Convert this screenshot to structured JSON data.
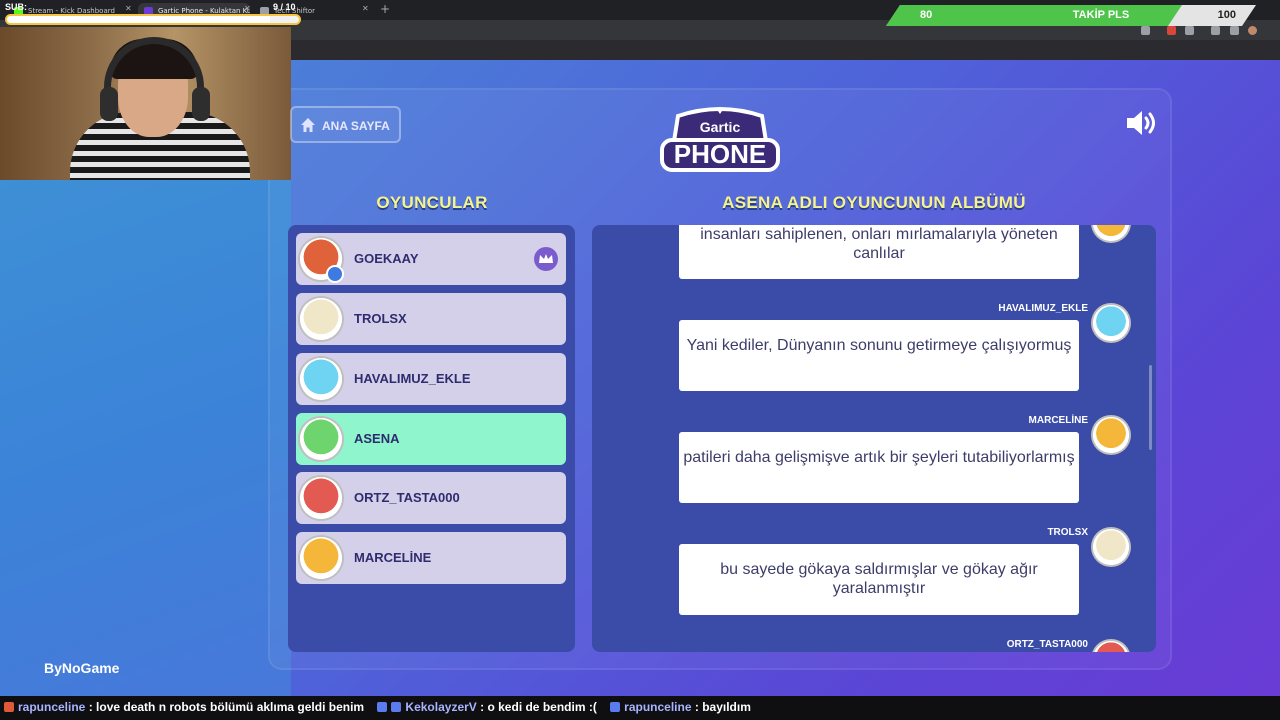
{
  "browser": {
    "tabs": [
      {
        "title": "Stream - Kick Dashboard",
        "fav_color": "#53fc18"
      },
      {
        "title": "Gartic Phone - Kulaktan Kulağa",
        "fav_color": "#6a3bd6"
      },
      {
        "title": "Tech Shiftor",
        "fav_color": "#9aa0a6"
      }
    ]
  },
  "overlay": {
    "sub_label": "SUB:",
    "sub_count": "9 / 10",
    "sub_progress": 0.9,
    "follow_current": "80",
    "follow_label": "TAKİP PLS",
    "follow_max": "100",
    "follow_progress": 0.8
  },
  "game": {
    "home_button": "ANA SAYFA",
    "logo_top": "Gartic",
    "logo_main": "PHONE",
    "players_heading": "OYUNCULAR",
    "album_heading": "ASENA ADLI OYUNCUNUN ALBÜMÜ",
    "players": [
      {
        "name": "GOEKAAY",
        "host": true,
        "active": false,
        "avatar_color": "#e0623a"
      },
      {
        "name": "TROLSX",
        "host": false,
        "active": false,
        "avatar_color": "#f0e7c8"
      },
      {
        "name": "HAVALIMUZ_EKLE",
        "host": false,
        "active": false,
        "avatar_color": "#6fd3f2"
      },
      {
        "name": "ASENA",
        "host": false,
        "active": true,
        "avatar_color": "#6ed46e"
      },
      {
        "name": "ORTZ_TASTA000",
        "host": false,
        "active": false,
        "avatar_color": "#e25a52"
      },
      {
        "name": "MARCELİNE",
        "host": false,
        "active": false,
        "avatar_color": "#f4b73a"
      }
    ],
    "album": [
      {
        "author": "",
        "text": "insanları sahiplenen, onları mırlamalarıyla yöneten canlılar",
        "avatar_color": "#f4b73a"
      },
      {
        "author": "HAVALIMUZ_EKLE",
        "text": "Yani kediler, Dünyanın sonunu getirmeye çalışıyormuş",
        "avatar_color": "#6fd3f2"
      },
      {
        "author": "MARCELİNE",
        "text": "patileri daha gelişmişve artık bir şeyleri tutabiliyorlarmış",
        "avatar_color": "#f4b73a"
      },
      {
        "author": "TROLSX",
        "text": "bu sayede gökaya saldırmışlar ve gökay ağır yaralanmıştır",
        "avatar_color": "#f0e7c8"
      },
      {
        "author": "ORTZ_TASTA000",
        "text": "",
        "avatar_color": "#e25a52"
      }
    ],
    "brand": "ByNoGame"
  },
  "chat": [
    {
      "user": "rapunceline",
      "message": ": love death n robots bölümü aklıma geldi benim"
    },
    {
      "user": "KekolayzerV",
      "message": ": o kedi de bendim :("
    },
    {
      "user": "rapunceline",
      "message": ": bayıldım"
    }
  ],
  "colors": {
    "accent_heading": "#f4f48a",
    "active_player": "#8ef5cc",
    "follow_green": "#4ec54a",
    "chat_user": "#a7b4ff"
  }
}
